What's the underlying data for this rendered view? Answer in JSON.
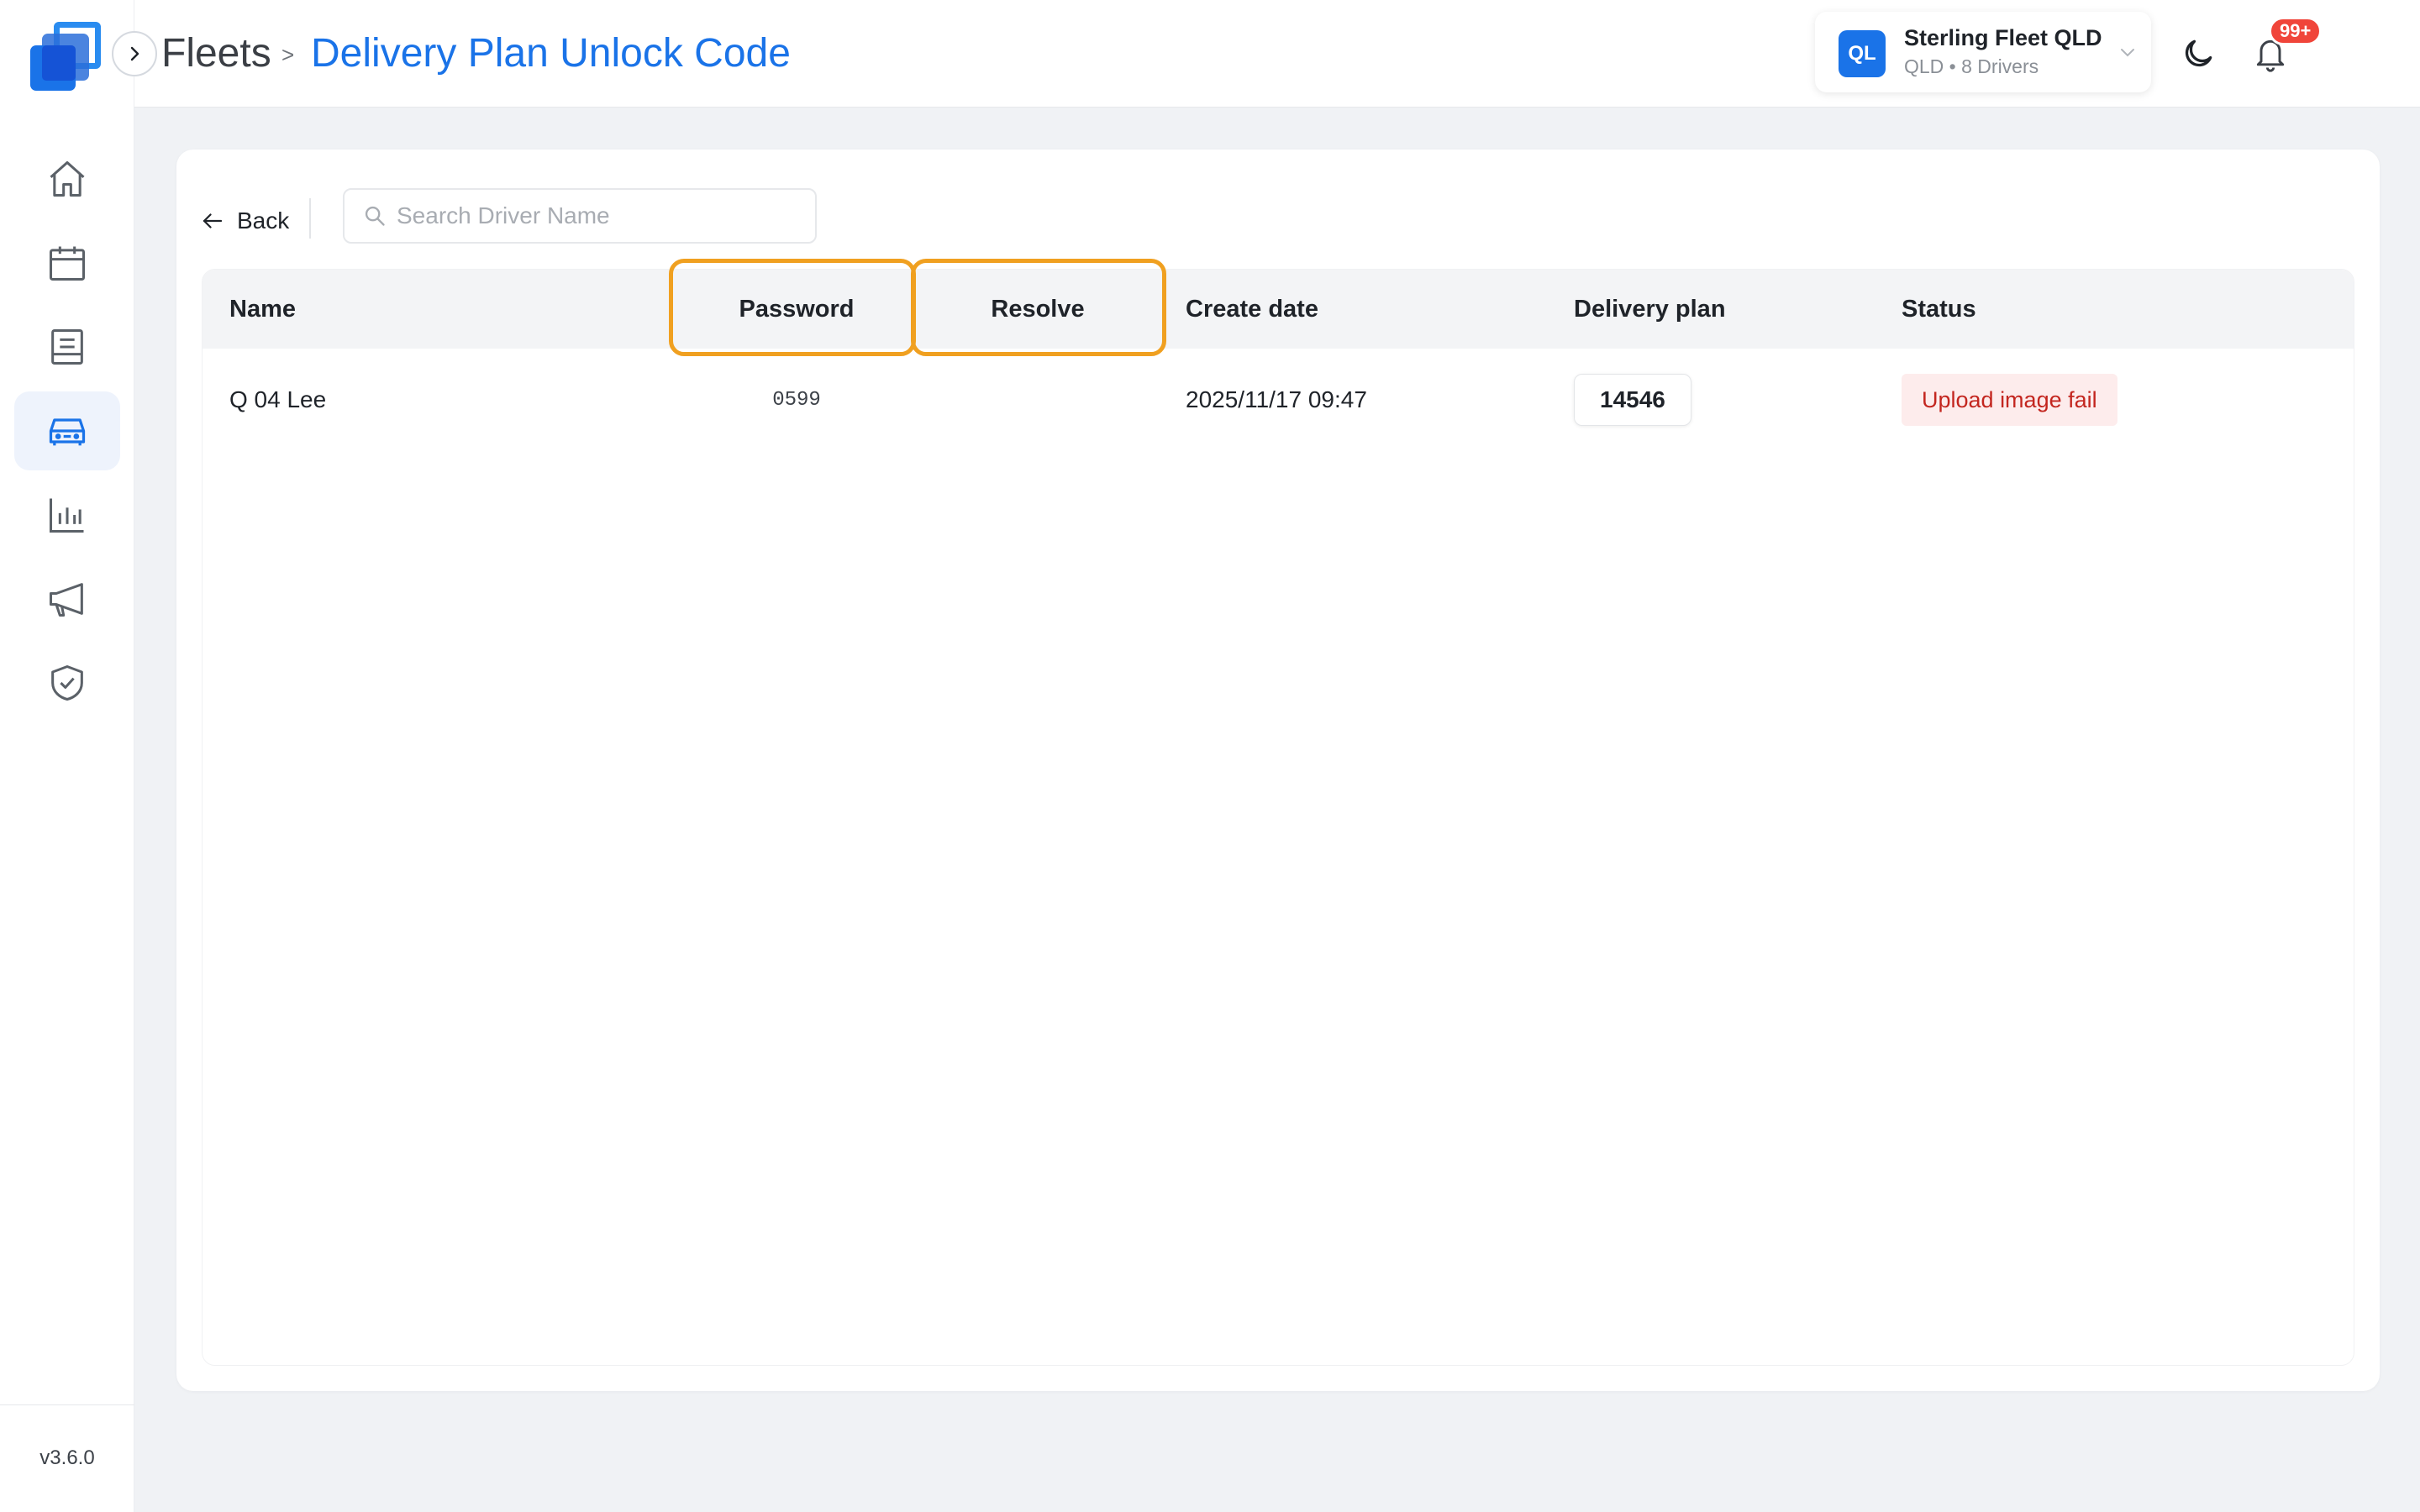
{
  "app": {
    "version": "v3.6.0"
  },
  "header": {
    "breadcrumb_root": "Fleets",
    "breadcrumb_separator": ">",
    "page_title": "Delivery Plan Unlock Code",
    "fleet": {
      "badge": "QL",
      "name": "Sterling Fleet QLD",
      "subtitle": "QLD • 8 Drivers"
    },
    "notifications_badge": "99+"
  },
  "sidebar": {
    "items": [
      {
        "icon": "home-icon",
        "active": false
      },
      {
        "icon": "calendar-icon",
        "active": false
      },
      {
        "icon": "document-list-icon",
        "active": false
      },
      {
        "icon": "car-icon",
        "active": true
      },
      {
        "icon": "bar-chart-icon",
        "active": false
      },
      {
        "icon": "megaphone-icon",
        "active": false
      },
      {
        "icon": "shield-check-icon",
        "active": false
      }
    ]
  },
  "toolbar": {
    "back_label": "Back",
    "search_placeholder": "Search Driver Name",
    "search_value": ""
  },
  "table": {
    "columns": [
      "Name",
      "Password",
      "Resolve",
      "Create date",
      "Delivery plan",
      "Status"
    ],
    "rows": [
      {
        "name": "Q 04 Lee",
        "password": "0599",
        "resolve": "",
        "create_date": "2025/11/17 09:47",
        "delivery_plan": "14546",
        "status": "Upload image fail"
      }
    ]
  },
  "colors": {
    "accent": "#1a73e8",
    "highlight": "#f0a020",
    "status_error_text": "#c3261f",
    "status_error_bg": "#fdecec",
    "notification": "#f0453a",
    "avatar": "#0b3d73"
  }
}
